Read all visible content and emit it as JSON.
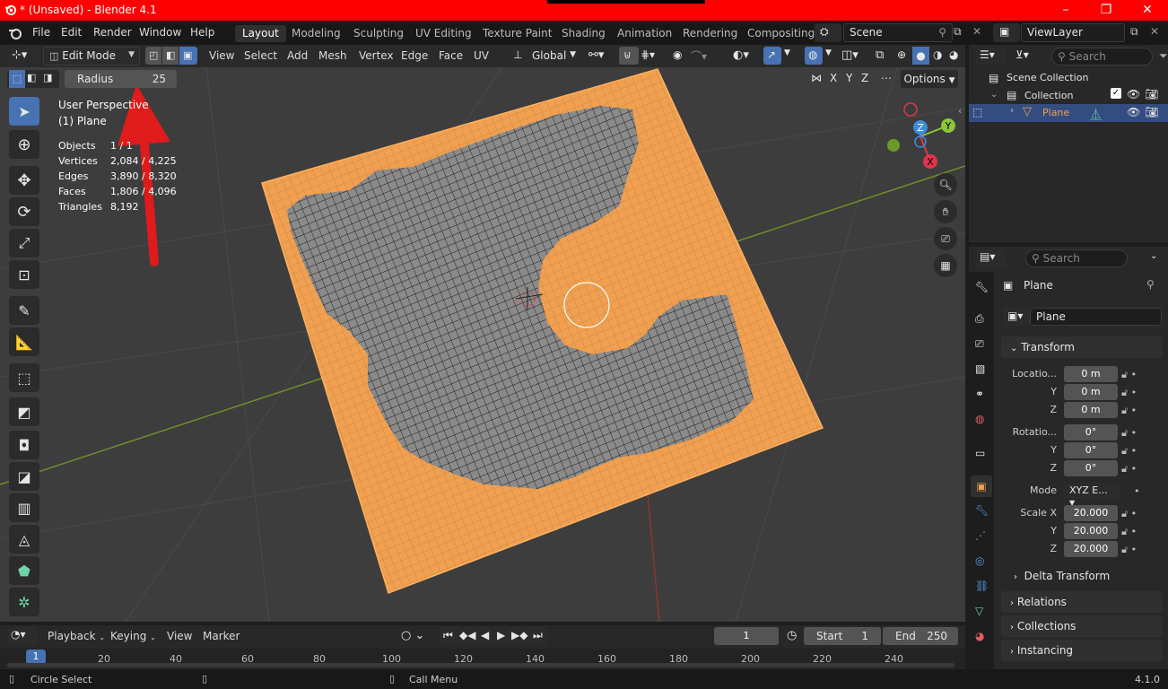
{
  "window": {
    "title": "* (Unsaved) - Blender 4.1",
    "controls": [
      "–",
      "❐",
      "✕"
    ]
  },
  "menu": [
    "File",
    "Edit",
    "Render",
    "Window",
    "Help"
  ],
  "workspaces": [
    "Layout",
    "Modeling",
    "Sculpting",
    "UV Editing",
    "Texture Paint",
    "Shading",
    "Animation",
    "Rendering",
    "Compositing"
  ],
  "scene": {
    "name": "Scene",
    "view_layer": "ViewLayer"
  },
  "viewport_header": {
    "mode": "Edit Mode",
    "menus": [
      "View",
      "Select",
      "Add",
      "Mesh",
      "Vertex",
      "Edge",
      "Face",
      "UV"
    ],
    "orientation": "Global",
    "options": "Options",
    "axes": [
      "X",
      "Y",
      "Z"
    ]
  },
  "tool_settings": {
    "radius_label": "Radius",
    "radius_value": "25"
  },
  "overlay": {
    "view_name": "User Perspective",
    "object_name": "(1) Plane",
    "stats": [
      {
        "label": "Objects",
        "value": "1 / 1"
      },
      {
        "label": "Vertices",
        "value": "2,084 / 4,225"
      },
      {
        "label": "Edges",
        "value": "3,890 / 8,320"
      },
      {
        "label": "Faces",
        "value": "1,806 / 4,096"
      },
      {
        "label": "Triangles",
        "value": "8,192"
      }
    ]
  },
  "gizmo": {
    "x": "X",
    "y": "Y",
    "z": "Z"
  },
  "outliner": {
    "search_placeholder": "Search",
    "items": [
      "Scene Collection",
      "Collection",
      "Plane"
    ]
  },
  "properties": {
    "search_placeholder": "Search",
    "object_name": "Plane",
    "data_name": "Plane",
    "transform": {
      "header": "Transform",
      "location_label": "Locatio...",
      "location": [
        "0 m",
        "0 m",
        "0 m"
      ],
      "rotation_label": "Rotatio...",
      "rotation": [
        "0°",
        "0°",
        "0°"
      ],
      "mode_label": "Mode",
      "mode_value": "XYZ E...",
      "scale_label": "Scale X",
      "scale": [
        "20.000",
        "20.000",
        "20.000"
      ],
      "axis_y": "Y",
      "axis_z": "Z"
    },
    "sections": [
      "Delta Transform",
      "Relations",
      "Collections",
      "Instancing"
    ]
  },
  "timeline": {
    "menus": [
      "Playback",
      "Keying",
      "View",
      "Marker"
    ],
    "current_frame": "1",
    "start_label": "Start",
    "start": "1",
    "end_label": "End",
    "end": "250",
    "ruler": [
      "20",
      "40",
      "60",
      "80",
      "100",
      "120",
      "140",
      "160",
      "180",
      "200",
      "220",
      "240"
    ],
    "playhead": "1"
  },
  "statusbar": {
    "left": "Circle Select",
    "mid": "Call Menu",
    "version": "4.1.0"
  },
  "colors": {
    "selected_mesh": "#f0a050",
    "accent": "#4772b3",
    "titlebar": "#ff0000",
    "annotation_arrow": "#e01b1b"
  }
}
